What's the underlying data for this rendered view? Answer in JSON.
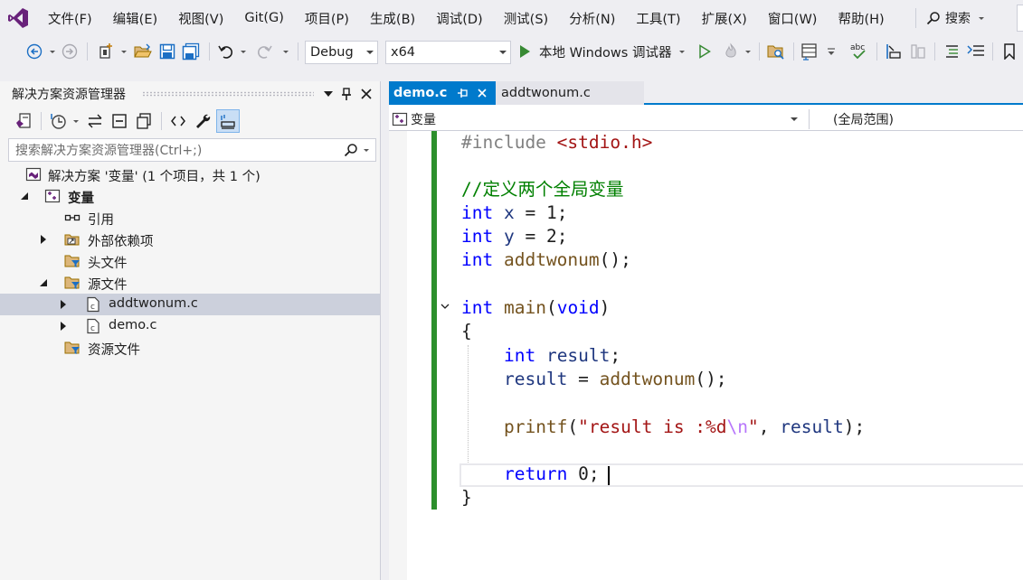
{
  "menu": {
    "items": [
      "文件(F)",
      "编辑(E)",
      "视图(V)",
      "Git(G)",
      "项目(P)",
      "生成(B)",
      "调试(D)",
      "测试(S)",
      "分析(N)",
      "工具(T)",
      "扩展(X)",
      "窗口(W)",
      "帮助(H)"
    ],
    "search_label": "搜索"
  },
  "toolbar": {
    "configuration": "Debug",
    "platform": "x64",
    "run_label": "本地 Windows 调试器"
  },
  "solution_explorer": {
    "title": "解决方案资源管理器",
    "search_placeholder": "搜索解决方案资源管理器(Ctrl+;)",
    "tree": [
      {
        "label": "解决方案 '变量' (1 个项目，共 1 个)",
        "icon": "solution-icon"
      },
      {
        "label": "变量",
        "icon": "cpp-project-icon",
        "bold": true
      },
      {
        "label": "引用",
        "icon": "references-icon"
      },
      {
        "label": "外部依赖项",
        "icon": "external-dependencies-icon"
      },
      {
        "label": "头文件",
        "icon": "filter-folder-icon"
      },
      {
        "label": "源文件",
        "icon": "filter-folder-icon"
      },
      {
        "label": "addtwonum.c",
        "icon": "c-file-icon",
        "selected": true
      },
      {
        "label": "demo.c",
        "icon": "c-file-icon"
      },
      {
        "label": "资源文件",
        "icon": "filter-folder-icon"
      }
    ]
  },
  "editor": {
    "tabs": [
      {
        "label": "demo.c",
        "active": true
      },
      {
        "label": "addtwonum.c",
        "active": false
      }
    ],
    "nav_project": "变量",
    "nav_scope": "(全局范围)",
    "code_lines": [
      "#include <stdio.h>",
      "",
      "//定义两个全局变量",
      "int x = 1;",
      "int y = 2;",
      "int addtwonum();",
      "",
      "int main(void)",
      "{",
      "    int result;",
      "    result = addtwonum();",
      "",
      "    printf(\"result is :%d\\n\", result);",
      "",
      "    return 0;",
      "}"
    ]
  },
  "colors": {
    "accent": "#007acc",
    "change_bar": "#2c8f2c",
    "keyword": "#0000ff",
    "comment": "#008000",
    "string": "#a31515",
    "function": "#74531f",
    "variable": "#1f377f",
    "selection": "#ccd0dc",
    "vs_logo": "#68217a"
  }
}
